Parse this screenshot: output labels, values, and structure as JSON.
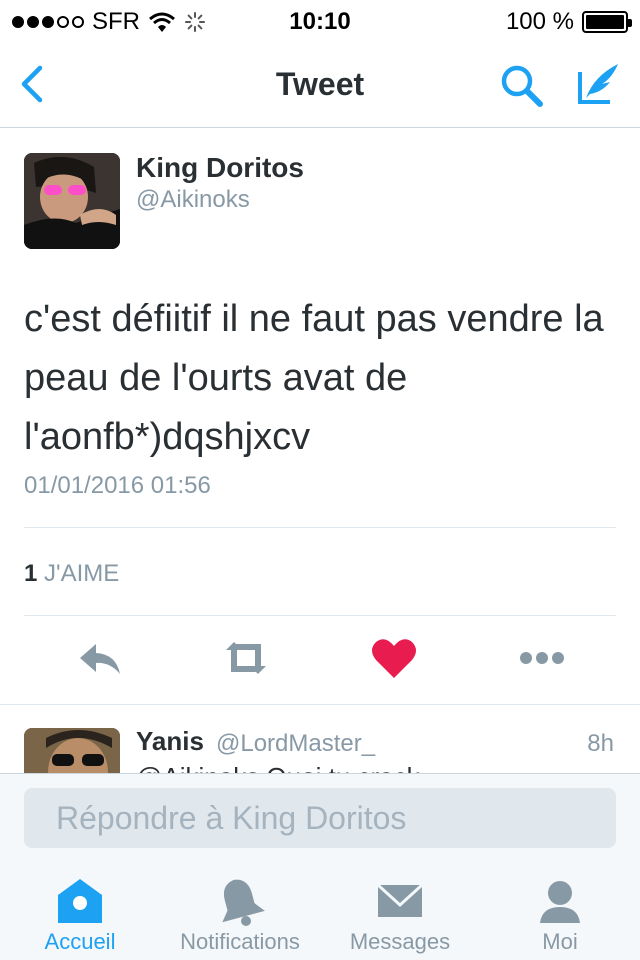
{
  "status_bar": {
    "carrier": "SFR",
    "time": "10:10",
    "battery": "100 %"
  },
  "nav": {
    "title": "Tweet",
    "icons": [
      "back-chevron-icon",
      "search-icon",
      "compose-icon"
    ]
  },
  "tweet": {
    "author_name": "King Doritos",
    "author_handle": "@Aikinoks",
    "text_lines": [
      "c'est défiitif il ne faut pas vendre la",
      "peau de l'ourts avat de",
      "l'aonfb*)dqshjxcv"
    ],
    "date": "01/01/2016 01:56",
    "likes_count": "1",
    "likes_label": "J'AIME",
    "actions": [
      "reply-icon",
      "retweet-icon",
      "like-icon",
      "more-icon"
    ]
  },
  "reply_preview": {
    "name": "Yanis",
    "handle": "@LordMaster_",
    "time": "8h",
    "text": "@Aikinoks Quoi tu crack"
  },
  "composer": {
    "placeholder": "Répondre à King Doritos"
  },
  "tabs": [
    {
      "label": "Accueil",
      "icon": "home-icon",
      "active": true
    },
    {
      "label": "Notifications",
      "icon": "bell-icon",
      "active": false
    },
    {
      "label": "Messages",
      "icon": "envelope-icon",
      "active": false
    },
    {
      "label": "Moi",
      "icon": "profile-icon",
      "active": false
    }
  ],
  "colors": {
    "accent": "#1da1f2",
    "like": "#e81c4f",
    "secondary_text": "#8899a6",
    "primary_text": "#292f33",
    "icon_gray": "#8899a6"
  }
}
